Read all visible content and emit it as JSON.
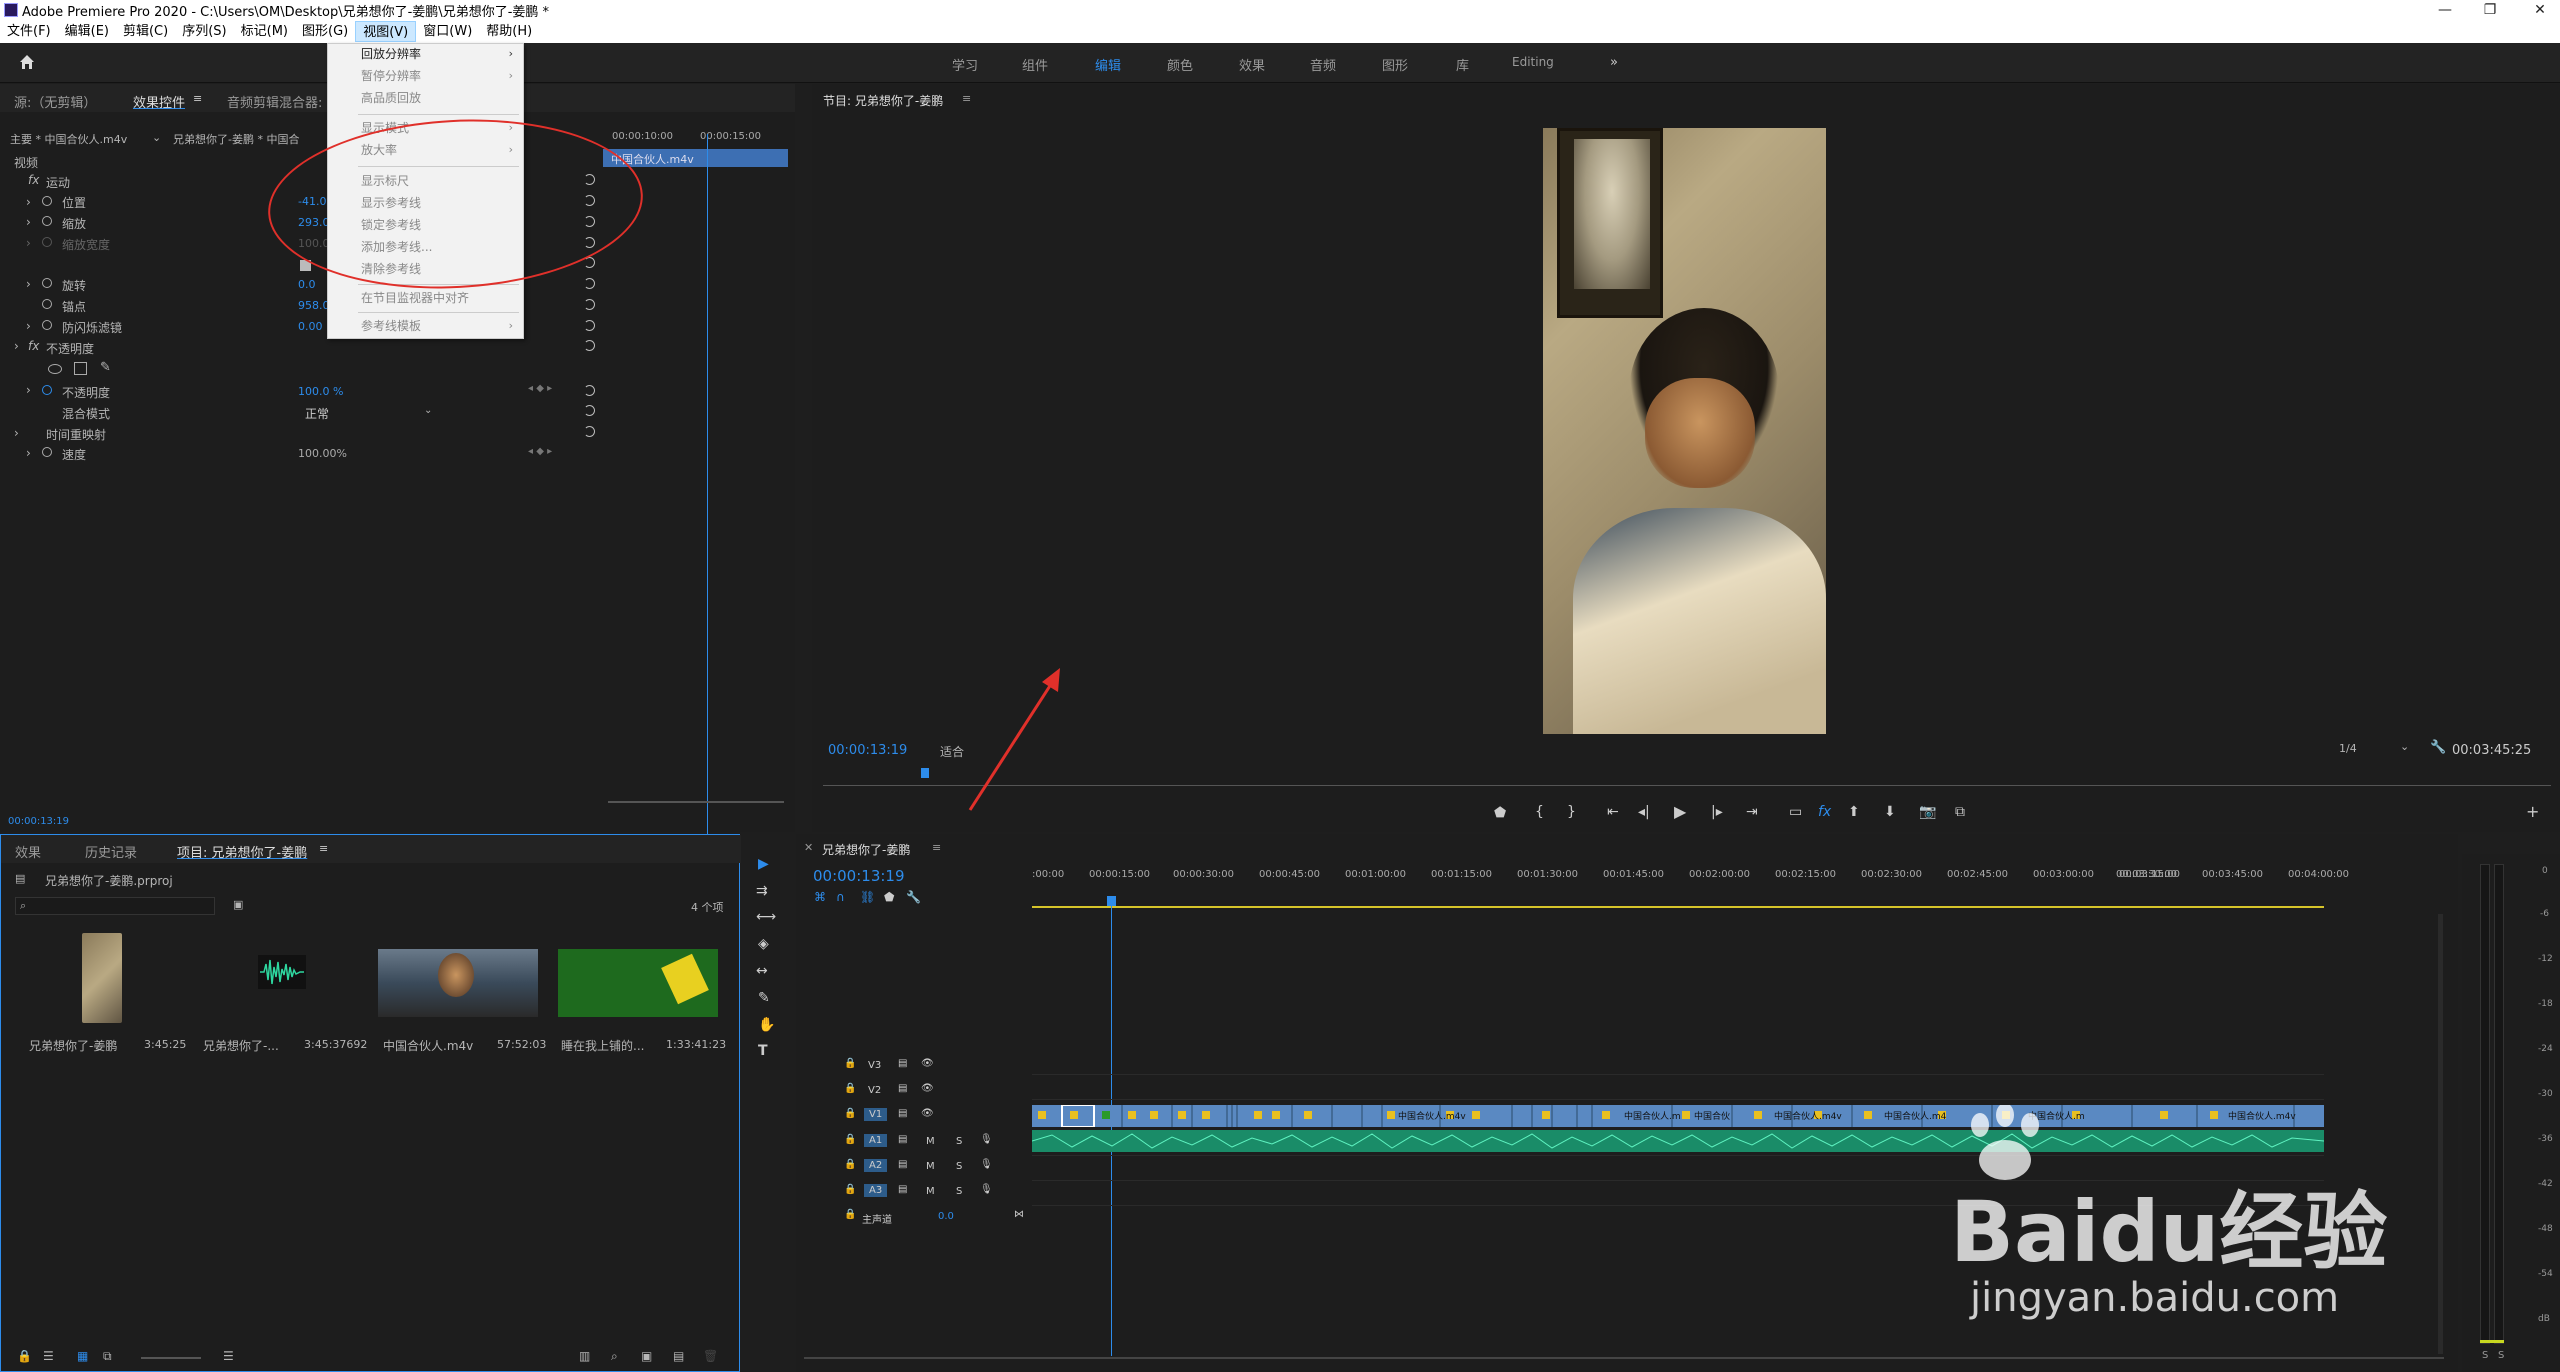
{
  "window": {
    "title": "Adobe Premiere Pro 2020 - C:\\Users\\OM\\Desktop\\兄弟想你了-姜鹏\\兄弟想你了-姜鹏 *"
  },
  "menubar": [
    "文件(F)",
    "编辑(E)",
    "剪辑(C)",
    "序列(S)",
    "标记(M)",
    "图形(G)",
    "视图(V)",
    "窗口(W)",
    "帮助(H)"
  ],
  "workspaces": [
    "学习",
    "组件",
    "编辑",
    "颜色",
    "效果",
    "音频",
    "图形",
    "库",
    "Editing"
  ],
  "view_menu": {
    "items": [
      {
        "label": "回放分辨率",
        "disabled": false,
        "submenu": true
      },
      {
        "label": "暂停分辨率",
        "disabled": true,
        "submenu": true
      },
      {
        "label": "高品质回放",
        "disabled": true,
        "submenu": false
      },
      {
        "label": "显示模式",
        "disabled": true,
        "submenu": true
      },
      {
        "label": "放大率",
        "disabled": true,
        "submenu": true
      },
      {
        "label": "显示标尺",
        "disabled": true,
        "submenu": false
      },
      {
        "label": "显示参考线",
        "disabled": true,
        "submenu": false
      },
      {
        "label": "锁定参考线",
        "disabled": true,
        "submenu": false
      },
      {
        "label": "添加参考线...",
        "disabled": true,
        "submenu": false
      },
      {
        "label": "清除参考线",
        "disabled": true,
        "submenu": false
      },
      {
        "label": "在节目监视器中对齐",
        "disabled": true,
        "submenu": false
      },
      {
        "label": "参考线模板",
        "disabled": true,
        "submenu": true
      }
    ]
  },
  "source_panel": {
    "tabs": [
      "源:（无剪辑）",
      "效果控件",
      "音频剪辑混合器:"
    ],
    "master": "主要 * 中国合伙人.m4v",
    "clip": "兄弟想你了-姜鹏 * 中国合",
    "time_start": "00:00:10:00",
    "time_mid": "00:00:15:00",
    "clip_label": "中国合伙人.m4v",
    "section_video": "视频",
    "fx_motion": "运动",
    "position": {
      "label": "位置",
      "value": "-41.0"
    },
    "scale": {
      "label": "缩放",
      "value": "293.0"
    },
    "scale_width": {
      "label": "缩放宽度",
      "value": "100.0"
    },
    "rotation": {
      "label": "旋转",
      "value": "0.0"
    },
    "anchor": {
      "label": "锚点",
      "value": "958.0"
    },
    "antiflicker": {
      "label": "防闪烁滤镜",
      "value": "0.00"
    },
    "fx_opacity": "不透明度",
    "opacity": {
      "label": "不透明度",
      "value": "100.0 %"
    },
    "blend": {
      "label": "混合模式",
      "value": "正常"
    },
    "time_remap": "时间重映射",
    "speed": {
      "label": "速度",
      "value": "100.00%"
    },
    "timecode": "00:00:13:19"
  },
  "program_panel": {
    "title": "节目: 兄弟想你了-姜鹏",
    "timecode": "00:00:13:19",
    "fit": "适合",
    "quality": "1/4",
    "duration": "00:03:45:25"
  },
  "project_panel": {
    "tabs": [
      "效果",
      "历史记录",
      "项目: 兄弟想你了-姜鹏"
    ],
    "file": "兄弟想你了-姜鹏.prproj",
    "count": "4 个项",
    "items": [
      {
        "name": "兄弟想你了-姜鹏",
        "duration": "3:45:25",
        "color": "#a08040"
      },
      {
        "name": "兄弟想你了-...",
        "duration": "3:45:37692",
        "color": "#2a2a2a"
      },
      {
        "name": "中国合伙人.m4v",
        "duration": "57:52:03",
        "color": "#4a5a6a"
      },
      {
        "name": "睡在我上铺的...",
        "duration": "1:33:41:23",
        "color": "#1e6a1e"
      }
    ]
  },
  "timeline": {
    "title": "兄弟想你了-姜鹏",
    "timecode": "00:00:13:19",
    "ruler": [
      ":00:00",
      "00:00:15:00",
      "00:00:30:00",
      "00:00:45:00",
      "00:01:00:00",
      "00:01:15:00",
      "00:01:30:00",
      "00:01:45:00",
      "00:02:00:00",
      "00:02:15:00",
      "00:02:30:00",
      "00:02:45:00",
      "00:03:00:00",
      "00:03:15:00",
      "00:03:30:00",
      "00:03:45:00",
      "00:04:00:00"
    ],
    "tracks": [
      "V3",
      "V2",
      "V1",
      "A1",
      "A2",
      "A3"
    ],
    "master": "主声道",
    "master_val": "0.0",
    "clip_labels": [
      "中国合伙人.m4v",
      "中国合伙人.m",
      "中国合伙",
      "中国合伙人.m4v",
      "中国合伙人.m4",
      "中国合伙人.m",
      "中国合伙人.m4v"
    ]
  },
  "meter": {
    "db": [
      "0",
      "-6",
      "-12",
      "-18",
      "-24",
      "-30",
      "-36",
      "-42",
      "-48",
      "-54",
      "dB"
    ],
    "solo": [
      "S",
      "S"
    ]
  },
  "watermark": {
    "brand": "Baidu经验",
    "url": "jingyan.baidu.com"
  }
}
